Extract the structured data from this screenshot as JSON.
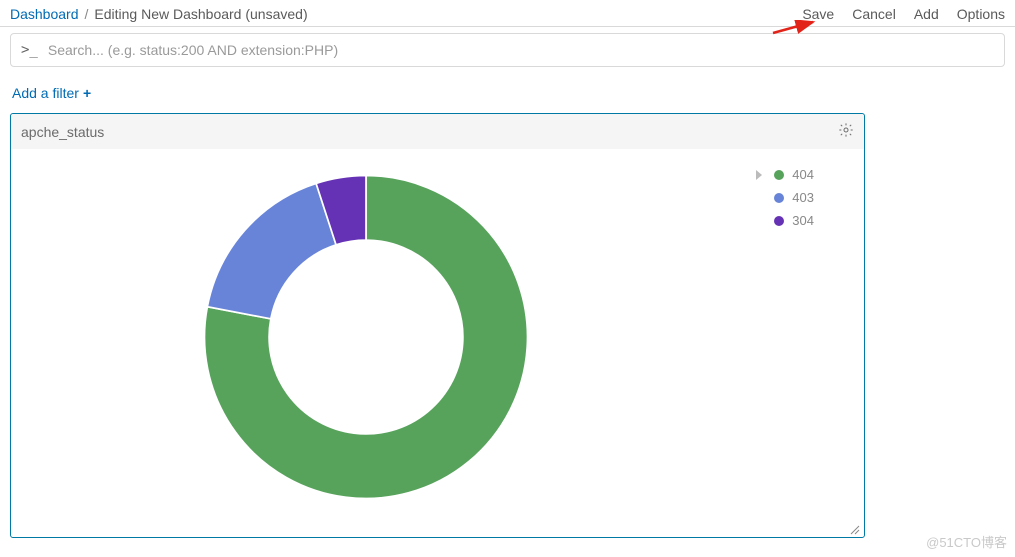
{
  "breadcrumb": {
    "root": "Dashboard",
    "current": "Editing New Dashboard (unsaved)"
  },
  "actions": {
    "save": "Save",
    "cancel": "Cancel",
    "add": "Add",
    "options": "Options"
  },
  "search": {
    "prompt": ">_",
    "placeholder": "Search... (e.g. status:200 AND extension:PHP)"
  },
  "filter": {
    "add_label": "Add a filter",
    "plus": "+"
  },
  "panel": {
    "title": "apche_status"
  },
  "chart_data": {
    "type": "pie",
    "donut": true,
    "series": [
      {
        "name": "404",
        "value": 78,
        "color": "#57a35c"
      },
      {
        "name": "403",
        "value": 17,
        "color": "#6784d8"
      },
      {
        "name": "304",
        "value": 5,
        "color": "#6632b5"
      }
    ],
    "title": "apche_status"
  },
  "watermark": "@51CTO博客"
}
